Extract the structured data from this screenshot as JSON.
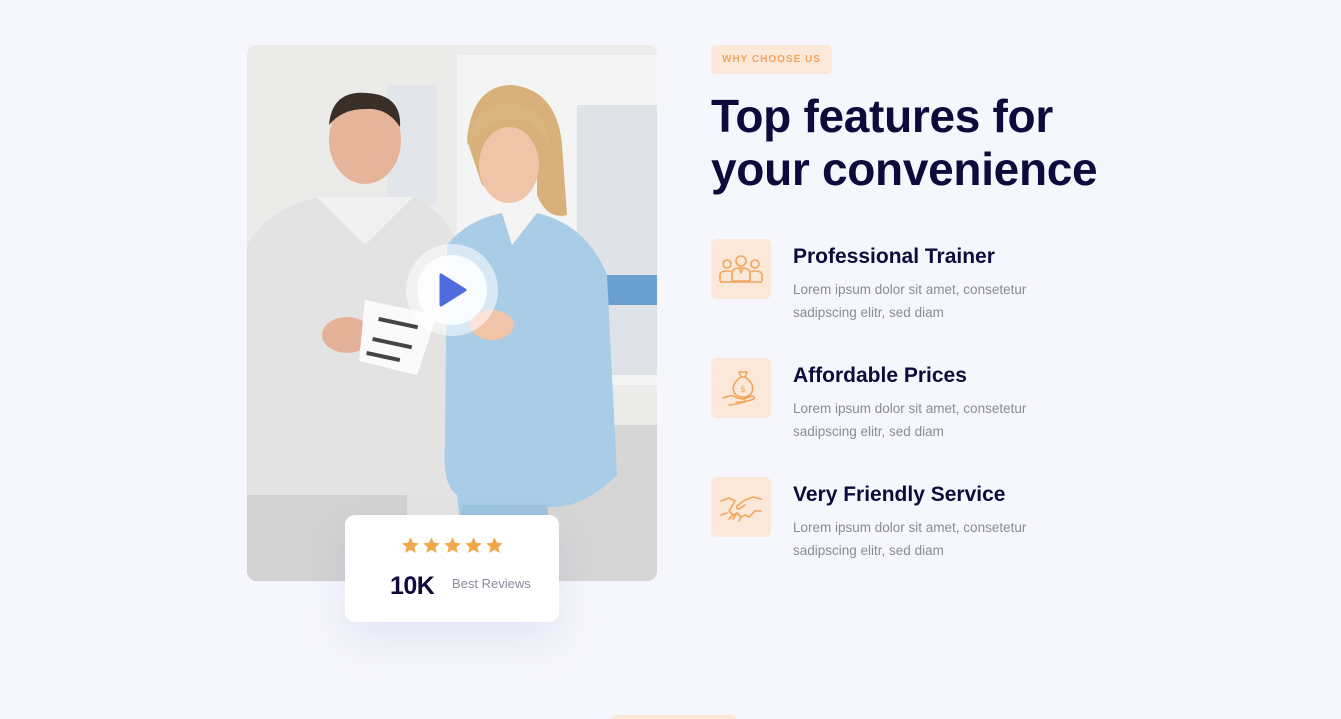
{
  "section": {
    "tag": "WHY CHOOSE US",
    "heading": "Top features for your convenience"
  },
  "media": {
    "image_icon": "doctors-photo",
    "play_icon": "play-icon"
  },
  "reviews": {
    "rating_stars": 5,
    "count": "10K",
    "label": "Best Reviews",
    "star_color": "#f0a84a"
  },
  "features": [
    {
      "icon": "team-icon",
      "title": "Professional Trainer",
      "description": "Lorem ipsum dolor sit amet, consetetur sadipscing elitr, sed diam"
    },
    {
      "icon": "money-hand-icon",
      "title": "Affordable Prices",
      "description": "Lorem ipsum dolor sit amet, consetetur sadipscing elitr, sed diam"
    },
    {
      "icon": "handshake-icon",
      "title": "Very Friendly Service",
      "description": "Lorem ipsum dolor sit amet, consetetur sadipscing elitr, sed diam"
    }
  ],
  "colors": {
    "heading": "#0f0a3c",
    "accent": "#f0a55c",
    "accent_bg": "#fbe8d8",
    "background": "#f6f7fc",
    "play": "#4f6be0"
  }
}
